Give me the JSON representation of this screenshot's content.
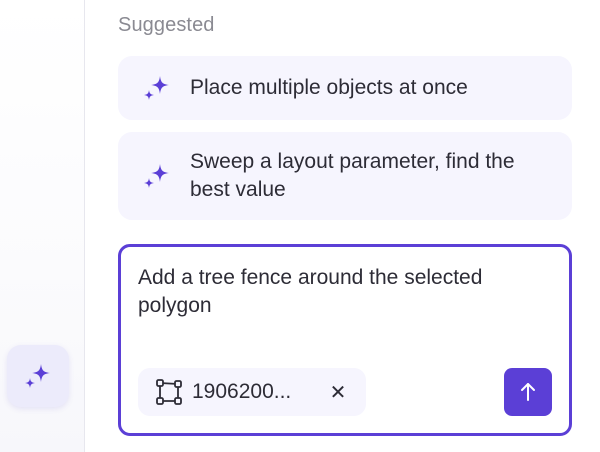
{
  "sidebar": {
    "ai_button_icon": "sparkles-icon"
  },
  "suggestions": {
    "heading": "Suggested",
    "items": [
      {
        "label": "Place multiple objects at once",
        "icon": "sparkles-icon"
      },
      {
        "label": "Sweep a layout parameter, find the best value",
        "icon": "sparkles-icon"
      }
    ]
  },
  "composer": {
    "text": "Add a tree fence around the selected polygon",
    "attachment": {
      "label": "1906200...",
      "icon": "polygon-icon",
      "remove_icon": "close-icon",
      "remove_glyph": "✕"
    },
    "send_icon": "arrow-up-icon"
  },
  "colors": {
    "accent": "#5b3fd6",
    "suggestion_bg": "#f6f5fe",
    "text": "#2d2c36",
    "muted": "#8a8a92"
  }
}
